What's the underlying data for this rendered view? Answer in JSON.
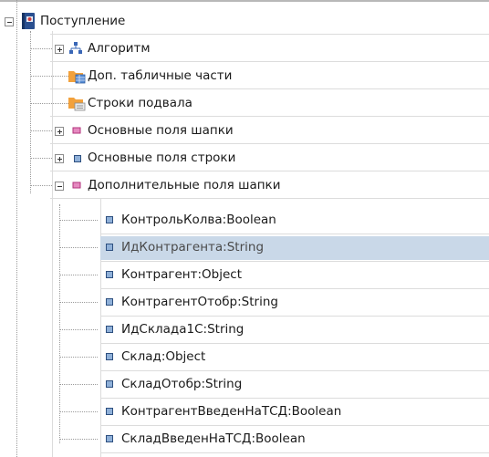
{
  "tree": {
    "root": {
      "label": "Поступление",
      "icon": "book-icon",
      "expanded": true
    },
    "children": [
      {
        "label": "Алгоритм",
        "icon": "algorithm-icon",
        "has_expander": true,
        "expanded": false
      },
      {
        "label": "Доп. табличные части",
        "icon": "table-folder-icon",
        "has_expander": false
      },
      {
        "label": "Строки подвала",
        "icon": "footer-folder-icon",
        "has_expander": false
      },
      {
        "label": "Основные поля шапки",
        "icon": "header-fields-icon",
        "has_expander": true,
        "expanded": false
      },
      {
        "label": "Основные поля строки",
        "icon": "row-fields-icon",
        "has_expander": true,
        "expanded": false
      },
      {
        "label": "Дополнительные поля шапки",
        "icon": "header-fields-icon",
        "has_expander": true,
        "expanded": true
      }
    ],
    "extra_header_fields": [
      "КонтрольКолва:Boolean",
      "ИдКонтрагента:String",
      "Контрагент:Object",
      "КонтрагентОтобр:String",
      "ИдСклада1С:String",
      "Склад:Object",
      "СкладОтобр:String",
      "КонтрагентВведенНаТСД:Boolean",
      "СкладВведенНаТСД:Boolean"
    ],
    "selected_field": "ИдКонтрагента:String"
  },
  "colors": {
    "selection": "#c9d8e8",
    "field_icon": "#8fb0d8",
    "header_icon": "#d96aa6"
  }
}
